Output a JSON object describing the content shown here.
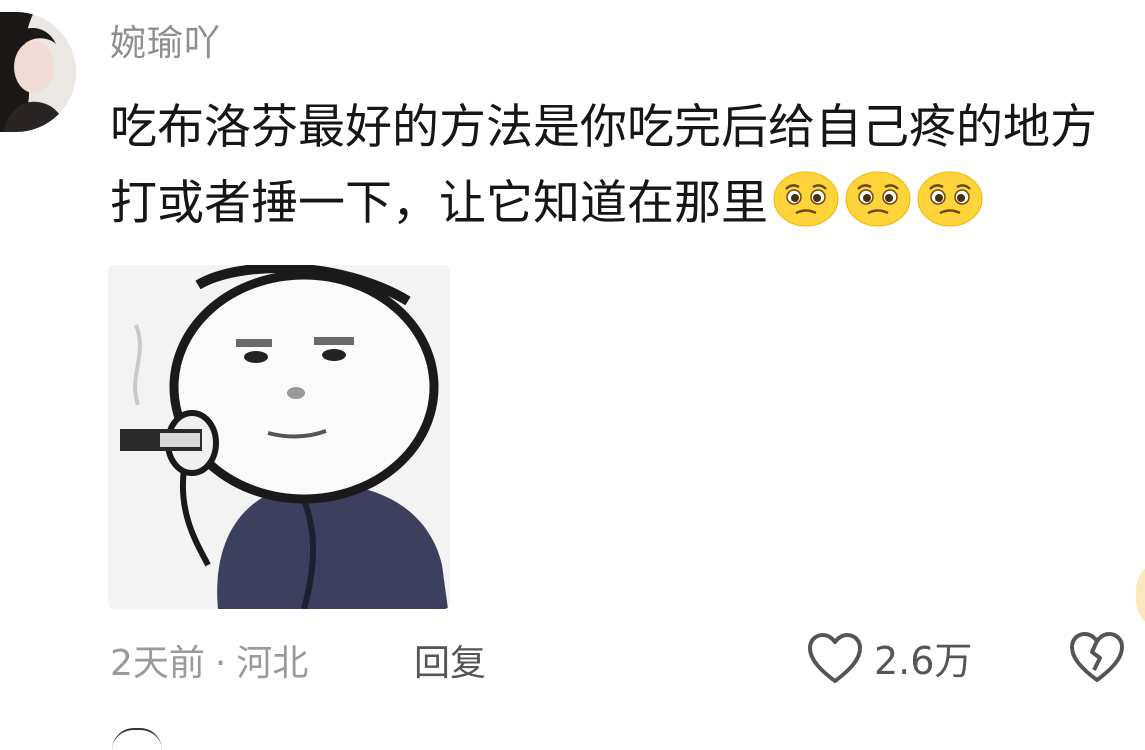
{
  "comment": {
    "username": "婉瑜吖",
    "text": "吃布洛芬最好的方法是你吃完后给自己疼的地方打或者捶一下，让它知道在那里",
    "emoji_icons": [
      "pleading-face-icon",
      "pleading-face-icon",
      "pleading-face-icon"
    ],
    "sticker_icon": "meme-sticker-icon",
    "meta": {
      "time": "2天前",
      "separator": "·",
      "location": "河北",
      "reply_label": "回复"
    },
    "likes": "2.6万"
  },
  "colors": {
    "username": "#8e8e8e",
    "text": "#161616",
    "meta": "#9a9a9a",
    "emoji": "#ffd43b"
  }
}
